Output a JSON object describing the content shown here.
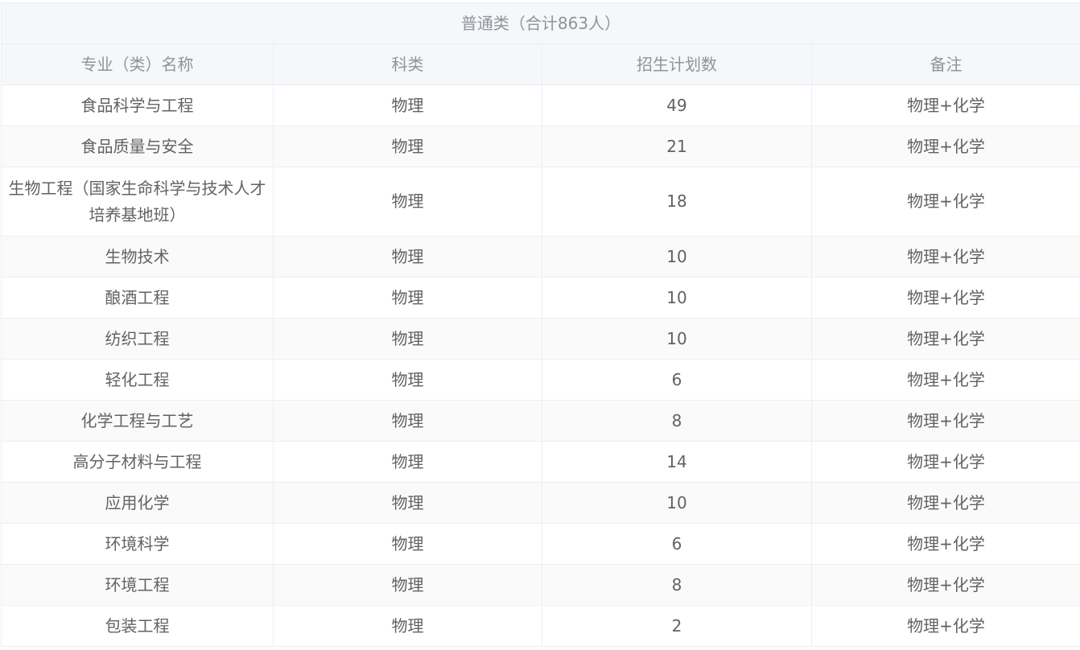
{
  "table": {
    "group_title": "普通类（合计863人）",
    "columns": [
      "专业（类）名称",
      "科类",
      "招生计划数",
      "备注"
    ],
    "rows": [
      {
        "name": "食品科学与工程",
        "category": "物理",
        "plan": "49",
        "note": "物理+化学"
      },
      {
        "name": "食品质量与安全",
        "category": "物理",
        "plan": "21",
        "note": "物理+化学"
      },
      {
        "name": "生物工程（国家生命科学与技术人才培养基地班）",
        "category": "物理",
        "plan": "18",
        "note": "物理+化学"
      },
      {
        "name": "生物技术",
        "category": "物理",
        "plan": "10",
        "note": "物理+化学"
      },
      {
        "name": "酿酒工程",
        "category": "物理",
        "plan": "10",
        "note": "物理+化学"
      },
      {
        "name": "纺织工程",
        "category": "物理",
        "plan": "10",
        "note": "物理+化学"
      },
      {
        "name": "轻化工程",
        "category": "物理",
        "plan": "6",
        "note": "物理+化学"
      },
      {
        "name": "化学工程与工艺",
        "category": "物理",
        "plan": "8",
        "note": "物理+化学"
      },
      {
        "name": "高分子材料与工程",
        "category": "物理",
        "plan": "14",
        "note": "物理+化学"
      },
      {
        "name": "应用化学",
        "category": "物理",
        "plan": "10",
        "note": "物理+化学"
      },
      {
        "name": "环境科学",
        "category": "物理",
        "plan": "6",
        "note": "物理+化学"
      },
      {
        "name": "环境工程",
        "category": "物理",
        "plan": "8",
        "note": "物理+化学"
      },
      {
        "name": "包装工程",
        "category": "物理",
        "plan": "2",
        "note": "物理+化学"
      }
    ]
  }
}
